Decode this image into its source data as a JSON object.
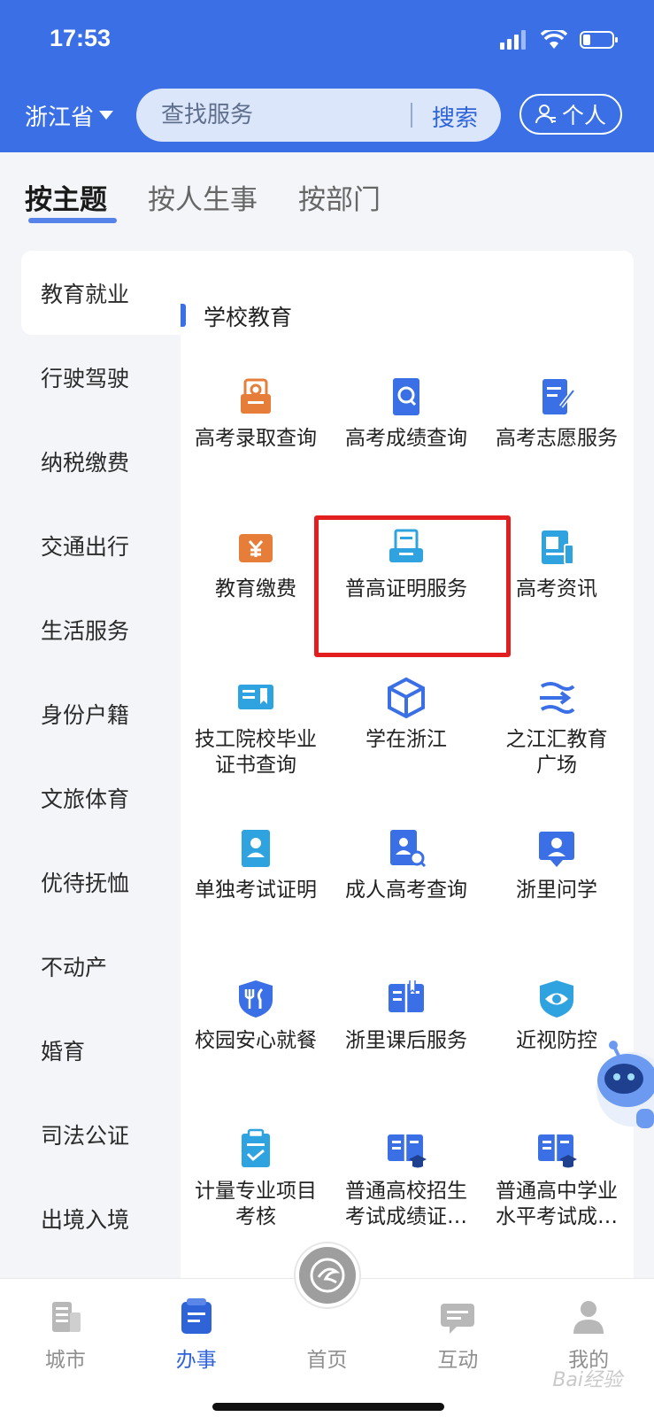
{
  "status_bar": {
    "time": "17:53"
  },
  "header": {
    "province": "浙江省",
    "search_placeholder": "查找服务",
    "search_button": "搜索",
    "personal_button": "个人"
  },
  "tabs": [
    {
      "label": "按主题",
      "active": true
    },
    {
      "label": "按人生事",
      "active": false
    },
    {
      "label": "按部门",
      "active": false
    }
  ],
  "sidenav": [
    {
      "label": "教育就业",
      "active": true
    },
    {
      "label": "行驶驾驶"
    },
    {
      "label": "纳税缴费"
    },
    {
      "label": "交通出行"
    },
    {
      "label": "生活服务"
    },
    {
      "label": "身份户籍"
    },
    {
      "label": "文旅体育"
    },
    {
      "label": "优待抚恤"
    },
    {
      "label": "不动产"
    },
    {
      "label": "婚育"
    },
    {
      "label": "司法公证"
    },
    {
      "label": "出境入境"
    }
  ],
  "section": {
    "title": "学校教育"
  },
  "services": [
    {
      "label": "高考录取查询",
      "icon": "admission-search-icon",
      "color": "#e67e3a"
    },
    {
      "label": "高考成绩查询",
      "icon": "score-search-icon",
      "color": "#3a6fe6"
    },
    {
      "label": "高考志愿服务",
      "icon": "application-form-icon",
      "color": "#3a6fe6"
    },
    {
      "label": "教育缴费",
      "icon": "yuan-payment-icon",
      "color": "#e67e3a"
    },
    {
      "label": "普高证明服务",
      "icon": "certificate-tray-icon",
      "color": "#2ea3e0"
    },
    {
      "label": "高考资讯",
      "icon": "news-icon",
      "color": "#2ea3e0"
    },
    {
      "label": "技工院校毕业\n证书查询",
      "icon": "diploma-icon",
      "color": "#2ea3e0"
    },
    {
      "label": "学在浙江",
      "icon": "cube-icon",
      "color": "#3a6fe6"
    },
    {
      "label": "之江汇教育\n广场",
      "icon": "stream-icon",
      "color": "#3a6fe6"
    },
    {
      "label": "单独考试证明",
      "icon": "id-card-icon",
      "color": "#2ea3e0"
    },
    {
      "label": "成人高考查询",
      "icon": "person-search-icon",
      "color": "#3a6fe6"
    },
    {
      "label": "浙里问学",
      "icon": "person-board-icon",
      "color": "#3a6fe6"
    },
    {
      "label": "校园安心就餐",
      "icon": "dining-shield-icon",
      "color": "#3a6fe6"
    },
    {
      "label": "浙里课后服务",
      "icon": "book-icon",
      "color": "#3a6fe6"
    },
    {
      "label": "近视防控",
      "icon": "eye-shield-icon",
      "color": "#2ea3e0"
    },
    {
      "label": "计量专业项目\n考核",
      "icon": "clipboard-check-icon",
      "color": "#2ea3e0"
    },
    {
      "label": "普通高校招生\n考试成绩证…",
      "icon": "open-book-cap-icon",
      "color": "#3a6fe6"
    },
    {
      "label": "普通高中学业\n水平考试成…",
      "icon": "open-book-cap-icon",
      "color": "#3a6fe6"
    }
  ],
  "bottom_nav": [
    {
      "label": "城市",
      "icon": "city-building-icon",
      "active": false
    },
    {
      "label": "办事",
      "icon": "document-icon",
      "active": true
    },
    {
      "label": "首页",
      "icon": "home-logo-icon",
      "active": false
    },
    {
      "label": "互动",
      "icon": "chat-icon",
      "active": false
    },
    {
      "label": "我的",
      "icon": "user-icon",
      "active": false
    }
  ],
  "watermark": "Bai经验",
  "colors": {
    "primary": "#3a6fe6",
    "highlight": "#e31e1e",
    "orange": "#e67e3a",
    "cyan": "#2ea3e0"
  }
}
